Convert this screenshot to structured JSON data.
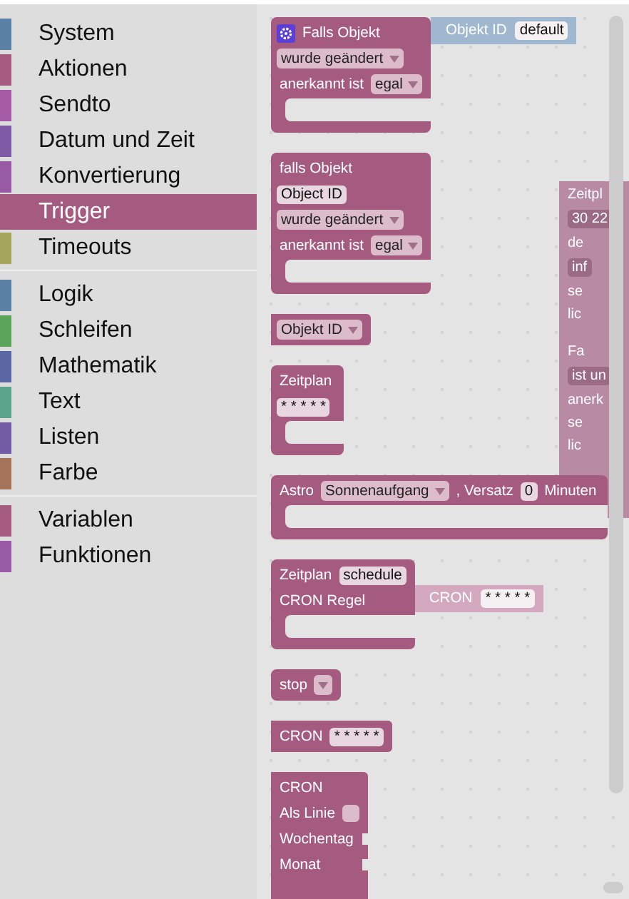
{
  "sidebar": {
    "groups": [
      {
        "items": [
          {
            "label": "System",
            "color": "#5b80a5",
            "selected": false
          },
          {
            "label": "Aktionen",
            "color": "#a55b80",
            "selected": false
          },
          {
            "label": "Sendto",
            "color": "#a55ba5",
            "selected": false
          },
          {
            "label": "Datum und Zeit",
            "color": "#805ba5",
            "selected": false
          },
          {
            "label": "Konvertierung",
            "color": "#995ba5",
            "selected": false
          },
          {
            "label": "Trigger",
            "color": "#a55b80",
            "selected": true
          },
          {
            "label": "Timeouts",
            "color": "#a5a55b",
            "selected": false
          }
        ]
      },
      {
        "items": [
          {
            "label": "Logik",
            "color": "#5b80a5",
            "selected": false
          },
          {
            "label": "Schleifen",
            "color": "#5ba55b",
            "selected": false
          },
          {
            "label": "Mathematik",
            "color": "#5b67a5",
            "selected": false
          },
          {
            "label": "Text",
            "color": "#5ba58c",
            "selected": false
          },
          {
            "label": "Listen",
            "color": "#745ba5",
            "selected": false
          },
          {
            "label": "Farbe",
            "color": "#a5745b",
            "selected": false
          }
        ]
      },
      {
        "items": [
          {
            "label": "Variablen",
            "color": "#a55b80",
            "selected": false
          },
          {
            "label": "Funktionen",
            "color": "#995ba5",
            "selected": false
          }
        ]
      }
    ]
  },
  "workspace": {
    "rows": [
      {
        "kind": "label",
        "text": "Zeitpl"
      },
      {
        "kind": "dropdown",
        "text": "30 22"
      },
      {
        "kind": "label",
        "text": "de"
      },
      {
        "kind": "dropdown",
        "text": "inf"
      },
      {
        "kind": "label",
        "text": "se"
      },
      {
        "kind": "label",
        "text": "lic"
      },
      {
        "kind": "gear",
        "text": "Fa"
      },
      {
        "kind": "dropdown",
        "text": "ist un"
      },
      {
        "kind": "label",
        "text": "anerk"
      },
      {
        "kind": "label",
        "text": "se"
      },
      {
        "kind": "label",
        "text": "lic"
      }
    ]
  },
  "flyout": {
    "blocks": [
      {
        "kind": "statement",
        "rows": [
          [
            {
              "kind": "gear"
            },
            {
              "kind": "label",
              "text": "Falls Objekt"
            },
            {
              "kind": "socket"
            }
          ],
          [
            {
              "kind": "dropdown",
              "text": "wurde geändert"
            }
          ],
          [
            {
              "kind": "label",
              "text": "anerkannt ist"
            },
            {
              "kind": "dropdown",
              "text": "egal"
            }
          ]
        ],
        "attached": {
          "color": "#9fb7cf",
          "parts": [
            {
              "kind": "label",
              "text": "Objekt ID"
            },
            {
              "kind": "field",
              "text": "default"
            }
          ]
        }
      },
      {
        "kind": "statement",
        "rows": [
          [
            {
              "kind": "label",
              "text": "falls Objekt"
            }
          ],
          [
            {
              "kind": "field",
              "text": "Object ID"
            }
          ],
          [
            {
              "kind": "dropdown",
              "text": "wurde geändert"
            }
          ],
          [
            {
              "kind": "label",
              "text": "anerkannt ist"
            },
            {
              "kind": "dropdown",
              "text": "egal"
            }
          ]
        ]
      },
      {
        "kind": "value",
        "rows": [
          [
            {
              "kind": "dropdown",
              "text": "Objekt ID"
            }
          ]
        ]
      },
      {
        "kind": "statement",
        "rows": [
          [
            {
              "kind": "label",
              "text": "Zeitplan"
            }
          ],
          [
            {
              "kind": "field",
              "text": "* * * * *"
            }
          ]
        ]
      },
      {
        "kind": "statement",
        "rows": [
          [
            {
              "kind": "label",
              "text": "Astro"
            },
            {
              "kind": "dropdown",
              "text": "Sonnenaufgang"
            },
            {
              "kind": "label",
              "text": ", Versatz"
            },
            {
              "kind": "field",
              "text": "0"
            },
            {
              "kind": "label",
              "text": "Minuten"
            }
          ]
        ]
      },
      {
        "kind": "statement",
        "rows": [
          [
            {
              "kind": "label",
              "text": "Zeitplan"
            },
            {
              "kind": "field",
              "text": "schedule"
            }
          ],
          [
            {
              "kind": "label",
              "text": "CRON Regel"
            },
            {
              "kind": "socket"
            }
          ]
        ],
        "attached": {
          "color": "#d4a9bf",
          "parts": [
            {
              "kind": "label",
              "text": "CRON"
            },
            {
              "kind": "field",
              "text": "* * * * *"
            }
          ]
        }
      },
      {
        "kind": "simple",
        "rows": [
          [
            {
              "kind": "label",
              "text": "stop"
            },
            {
              "kind": "dropdown"
            }
          ]
        ]
      },
      {
        "kind": "value",
        "rows": [
          [
            {
              "kind": "label",
              "text": "CRON"
            },
            {
              "kind": "field",
              "text": "* * * * *"
            }
          ]
        ]
      },
      {
        "kind": "value",
        "rows": [
          [
            {
              "kind": "label",
              "text": "CRON"
            }
          ],
          [
            {
              "kind": "label",
              "text": "Als Linie"
            },
            {
              "kind": "checkbox",
              "checked": false
            }
          ],
          [
            {
              "kind": "label",
              "text": "Wochentag"
            },
            {
              "kind": "input"
            }
          ],
          [
            {
              "kind": "label",
              "text": "Monat"
            },
            {
              "kind": "input"
            }
          ],
          [
            {
              "kind": "blank"
            }
          ]
        ]
      }
    ]
  }
}
